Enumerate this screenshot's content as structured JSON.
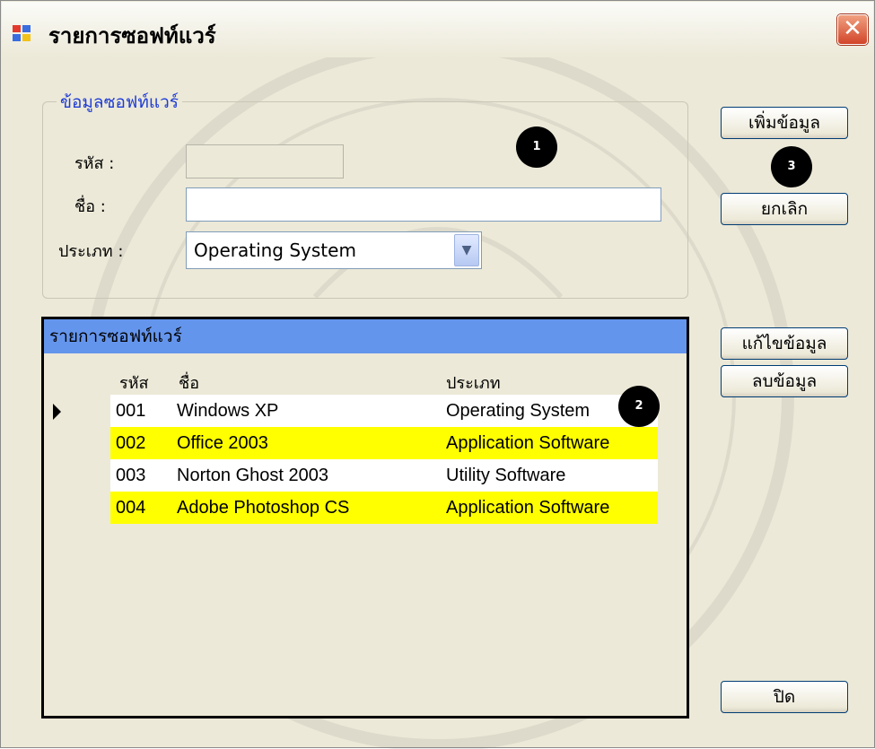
{
  "window": {
    "title": "รายการซอฟท์แวร์",
    "close_glyph": "✕"
  },
  "form": {
    "group_title": "ข้อมูลซอฟท์แวร์",
    "code_label": "รหัส :",
    "code_value": "",
    "name_label": "ชื่อ :",
    "name_value": "",
    "type_label": "ประเภท :",
    "type_selected": "Operating System",
    "type_dropdown_glyph": "▼"
  },
  "buttons": {
    "add": "เพิ่มข้อมูล",
    "cancel": "ยกเลิก",
    "edit": "แก้ไขข้อมูล",
    "delete": "ลบข้อมูล",
    "close": "ปิด"
  },
  "grid": {
    "caption": "รายการซอฟท์แวร์",
    "columns": [
      "รหัส",
      "ชื่อ",
      "ประเภท"
    ],
    "rows": [
      {
        "code": "001",
        "name": "Windows XP",
        "type": "Operating System"
      },
      {
        "code": "002",
        "name": "Office 2003",
        "type": "Application Software"
      },
      {
        "code": "003",
        "name": "Norton Ghost 2003",
        "type": "Utility Software"
      },
      {
        "code": "004",
        "name": "Adobe Photoshop CS",
        "type": "Application Software"
      }
    ]
  },
  "callouts": {
    "one": "1",
    "two": "2",
    "three": "3"
  },
  "icons": {
    "app": "form-icon",
    "close": "close-icon",
    "dropdown": "chevron-down-icon",
    "row_pointer": "row-pointer-icon"
  },
  "colors": {
    "grid_caption": "#6495ED",
    "row_highlight": "#FFFF00",
    "legend_text": "#1E3BD6",
    "close_button": "#D2452A"
  }
}
